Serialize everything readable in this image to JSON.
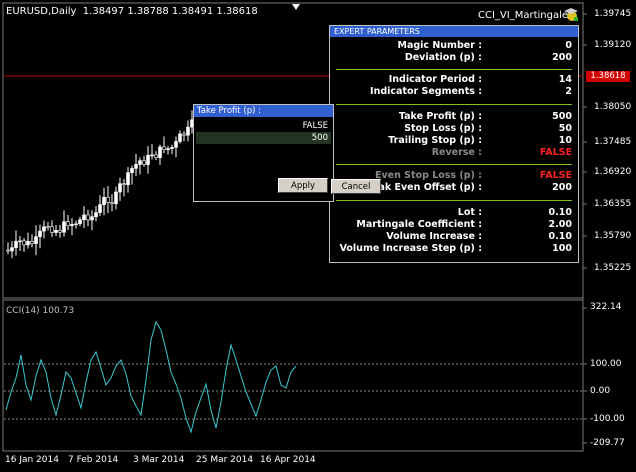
{
  "symbol_line": "EURUSD,Daily  1.38497 1.38788 1.38491 1.38618",
  "expert_name": "CCI_VI_Martingale",
  "icons": {
    "expert_icon": "graduation-cap-smiley-icon",
    "top_marker": "triangle-down-icon"
  },
  "price_axis": [
    "1.39745",
    "1.39120",
    "1.38618",
    "1.38050",
    "1.37485",
    "1.36920",
    "1.36355",
    "1.35790",
    "1.35225"
  ],
  "current_price": "1.38618",
  "cci": {
    "title": "CCI(14) 100.73",
    "axis": [
      "322.14",
      "100.00",
      "0.00",
      "-100.00",
      "-209.77"
    ]
  },
  "date_axis": [
    "16 Jan 2014",
    "7 Feb 2014",
    "3 Mar 2014",
    "25 Mar 2014",
    "16 Apr 2014"
  ],
  "panel": {
    "title": "EXPERT  PARAMETERS",
    "rows": [
      {
        "label": "Magic Number :",
        "value": "0"
      },
      {
        "label": "Deviation (p) :",
        "value": "200"
      },
      {
        "label": "Indicator Period :",
        "value": "14"
      },
      {
        "label": "Indicator Segments :",
        "value": "2"
      },
      {
        "label": "Take Profit (p) :",
        "value": "500"
      },
      {
        "label": "Stop Loss (p) :",
        "value": "50"
      },
      {
        "label": "Trailing Stop (p) :",
        "value": "10"
      },
      {
        "label": "Reverse :",
        "value": "FALSE"
      },
      {
        "label": "Even Stop Loss (p) :",
        "value": "FALSE"
      },
      {
        "label": "eak Even Offset (p) :",
        "value": "200"
      },
      {
        "label": "Lot :",
        "value": "0.10"
      },
      {
        "label": "Martingale Coefficient :",
        "value": "2.00"
      },
      {
        "label": "Volume Increase :",
        "value": "0.10"
      },
      {
        "label": "Volume Increase Step (p) :",
        "value": "100"
      }
    ]
  },
  "dialog": {
    "title": "Take Profit (p) :",
    "options": [
      "FALSE",
      "500"
    ],
    "apply_label": "Apply",
    "cancel_label": "Cancel"
  }
}
